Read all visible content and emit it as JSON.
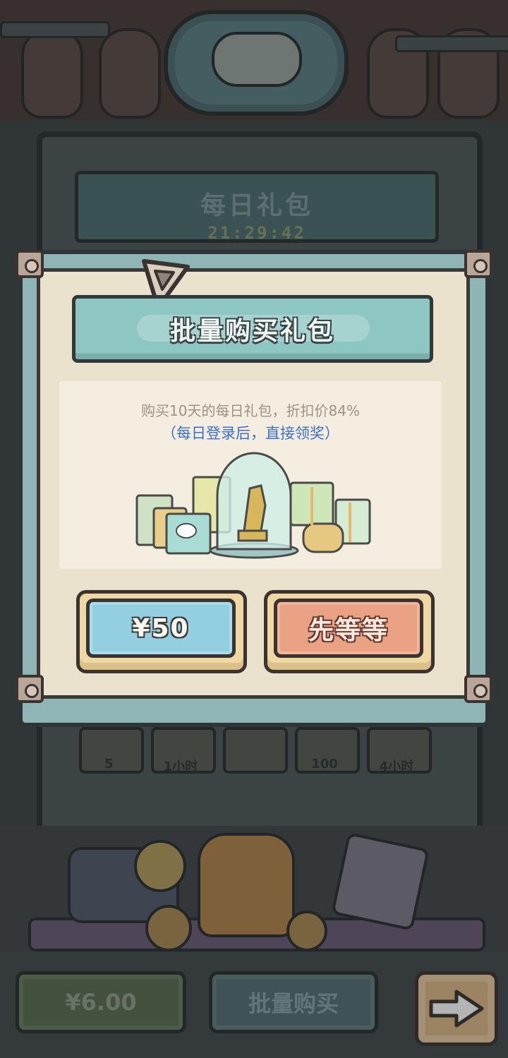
{
  "background_panel": {
    "title": "每日礼包",
    "timer": "21:29:42",
    "rewards": [
      {
        "icon": "statue-icon",
        "label": "5"
      },
      {
        "icon": "hourglass-icon",
        "label": "1小时"
      },
      {
        "icon": "safe-icon",
        "label": ""
      },
      {
        "icon": "ghost-icon",
        "label": "100"
      },
      {
        "icon": "ghost-cat-icon",
        "label": "4小时"
      }
    ]
  },
  "bottom_bar": {
    "price_label": "¥6.00",
    "batch_buy_label": "批量购买",
    "next_icon": "arrow-right-icon"
  },
  "modal": {
    "title": "批量购买礼包",
    "description": "购买10天的每日礼包，折扣价84%",
    "subdescription": "（每日登录后，直接领奖）",
    "buy_label": "¥50",
    "wait_label": "先等等",
    "colors": {
      "header": "#8ec6c4",
      "buy_button": "#93cfe0",
      "wait_button": "#e9a384",
      "subdescription": "#3f6fc8"
    }
  }
}
